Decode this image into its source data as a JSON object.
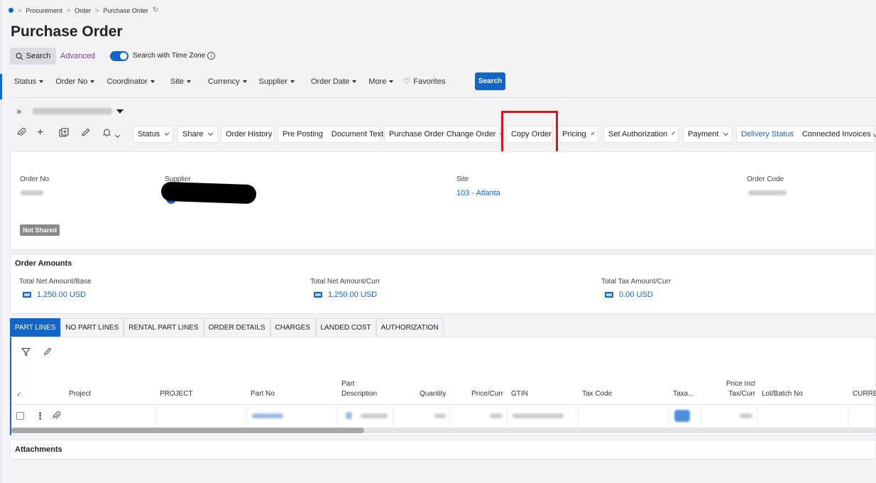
{
  "breadcrumb": {
    "items": [
      "Procurement",
      "Order",
      "Purchase Order"
    ]
  },
  "page": {
    "title": "Purchase Order"
  },
  "search": {
    "button_label": "Search",
    "advanced_label": "Advanced",
    "timezone_label": "Search with Time Zone",
    "timezone_enabled": true
  },
  "filters": {
    "items": [
      "Status",
      "Order No",
      "Coordinator",
      "Site",
      "Currency",
      "Supplier",
      "Order Date",
      "More"
    ],
    "favorites_label": "Favorites",
    "search_button": "Search"
  },
  "toolbar": {
    "buttons": [
      "Status",
      "Share",
      "Order History",
      "Pre Posting",
      "Document Text",
      "Purchase Order Change Order",
      "Copy Order",
      "Pricing",
      "Set Authorization",
      "Payment",
      "Delivery Status",
      "Connected Invoices"
    ]
  },
  "header": {
    "order_no_label": "Order No",
    "supplier_label": "Supplier",
    "site_label": "Site",
    "site_value": "103 - Atlanta",
    "order_code_label": "Order Code",
    "shared_badge": "Not Shared"
  },
  "amounts": {
    "title": "Order Amounts",
    "items": [
      {
        "label": "Total Net Amount/Base",
        "value": "1,250.00 USD"
      },
      {
        "label": "Total Net Amount/Curr",
        "value": "1,250.00 USD"
      },
      {
        "label": "Total Tax Amount/Curr",
        "value": "0.00 USD"
      }
    ]
  },
  "tabs": [
    "PART LINES",
    "NO PART LINES",
    "RENTAL PART LINES",
    "ORDER DETAILS",
    "CHARGES",
    "LANDED COST",
    "AUTHORIZATION"
  ],
  "grid": {
    "columns": [
      "Project",
      "PROJECT",
      "Part No",
      "Part Description",
      "Quantity",
      "Price/Curr",
      "GTIN",
      "Tax Code",
      "Taxa...",
      "Price Incl Tax/Curr",
      "Lot/Batch No",
      "CURREN"
    ]
  },
  "attachments": {
    "title": "Attachments"
  },
  "colors": {
    "accent": "#1466c6",
    "highlight": "#d9141b",
    "advanced": "#7a3b8c"
  }
}
